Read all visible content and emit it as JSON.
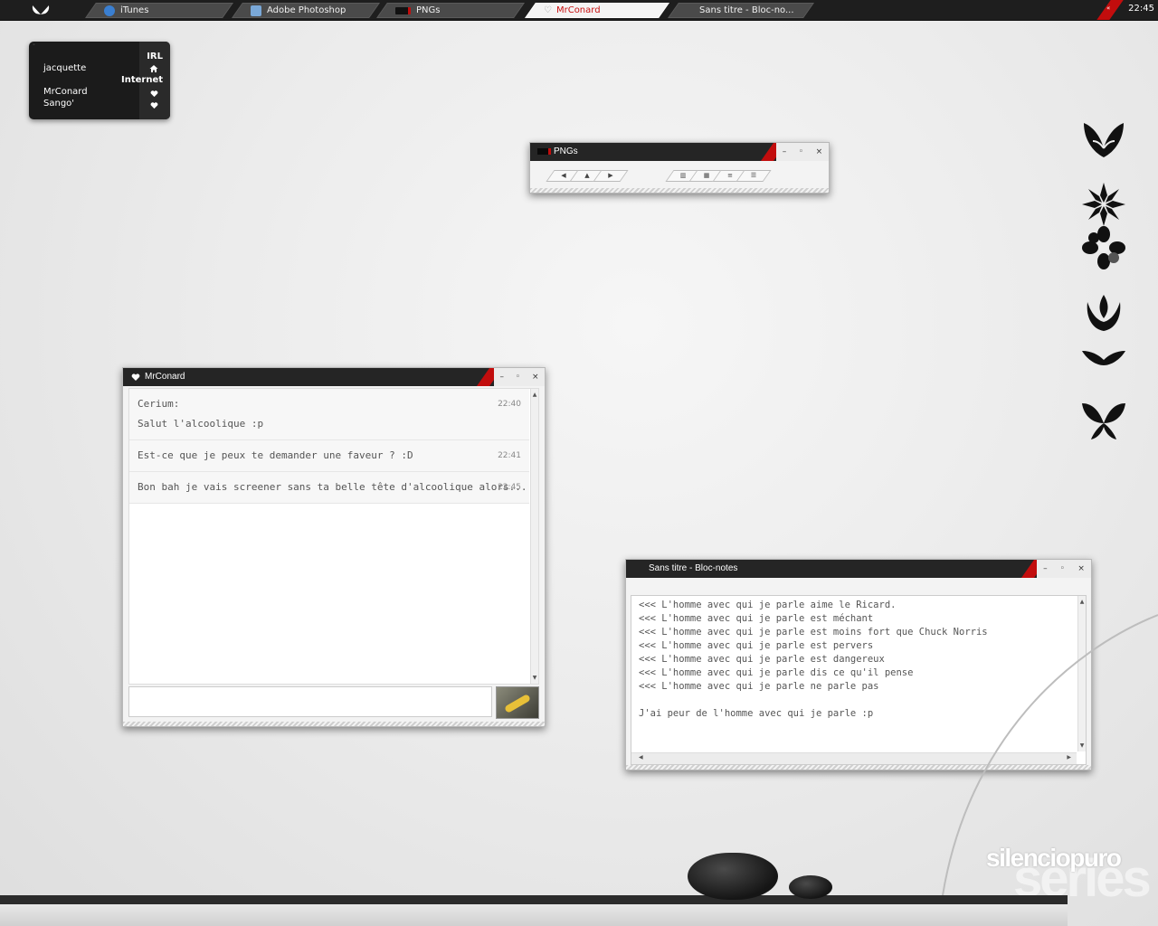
{
  "taskbar": {
    "tasks": [
      {
        "label": "iTunes",
        "icon": "itunes-icon"
      },
      {
        "label": "Adobe Photoshop",
        "icon": "photoshop-icon"
      },
      {
        "label": "PNGs",
        "icon": "folder-icon"
      },
      {
        "label": "MrConard",
        "icon": "heart-icon"
      },
      {
        "label": "Sans titre - Bloc-no...",
        "icon": ""
      }
    ],
    "active_task": "MrConard",
    "clock": "22:45"
  },
  "contacts": {
    "groups": {
      "irl": "IRL",
      "internet": "Internet"
    },
    "items": [
      {
        "name": "jacquette"
      },
      {
        "name": "MrConard"
      },
      {
        "name": "Sango'"
      }
    ]
  },
  "pngs_window": {
    "title": "PNGs",
    "nav_buttons": [
      "back-icon",
      "up-icon",
      "forward-icon"
    ],
    "view_buttons": [
      "view-tiles-icon",
      "view-icons-icon",
      "view-list-icon",
      "view-details-icon"
    ],
    "window_buttons": [
      "–",
      "◦",
      "×"
    ]
  },
  "chat_window": {
    "title": "MrConard",
    "window_buttons": [
      "–",
      "◦",
      "×"
    ],
    "messages": [
      {
        "sender": "Cerium:",
        "text": "Salut l'alcoolique :p",
        "time": "22:40"
      },
      {
        "text": "Est-ce que je peux te demander une faveur ? :D",
        "time": "22:41"
      },
      {
        "text": "Bon bah je vais screener sans ta belle tête d'alcoolique alors...",
        "time": "22:45"
      }
    ],
    "input_value": ""
  },
  "notepad_window": {
    "title": "Sans titre - Bloc-notes",
    "window_buttons": [
      "–",
      "◦",
      "×"
    ],
    "lines": [
      "<<< L'homme avec qui je parle aime le Ricard.",
      "<<< L'homme avec qui je parle est méchant",
      "<<< L'homme avec qui je parle est moins fort que Chuck Norris",
      "<<< L'homme avec qui je parle est pervers",
      "<<< L'homme avec qui je parle est dangereux",
      "<<< L'homme avec qui je parle dis ce qu'il pense",
      "<<< L'homme avec qui je parle ne parle pas",
      "",
      "J'ai peur de l'homme avec qui je parle :p"
    ]
  },
  "desktop": {
    "brand": "silenciopuro",
    "brand_ghost": "series",
    "accent_color": "#c20d0d",
    "dark_color": "#1e1e1e"
  }
}
